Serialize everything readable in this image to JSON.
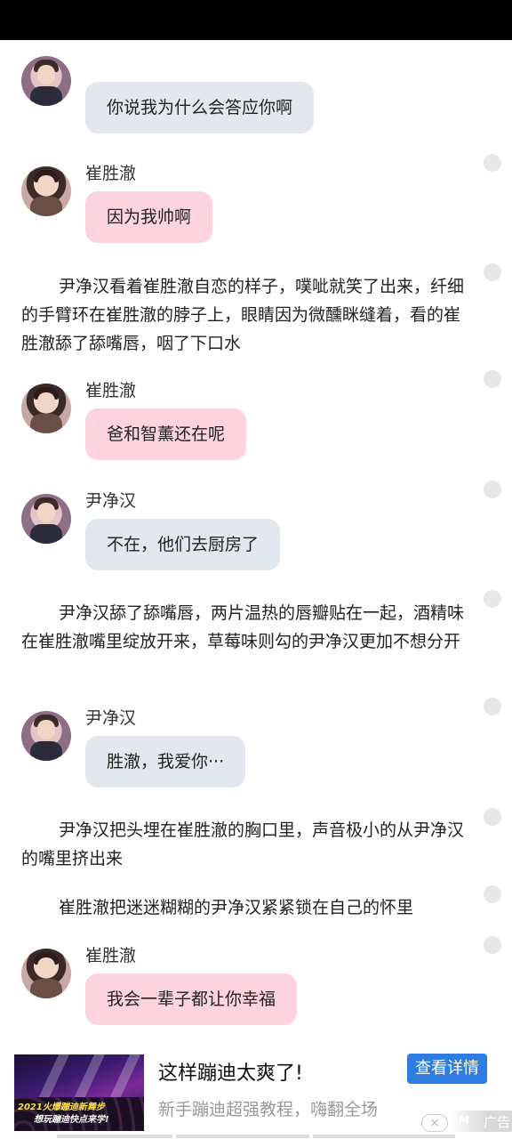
{
  "messages": [
    {
      "text": "你说我为什么会答应你啊"
    },
    {
      "name": "崔胜澈",
      "text": "因为我帅啊"
    },
    {
      "narration": "尹净汉看着崔胜澈自恋的样子，噗呲就笑了出来，纤细的手臂环在崔胜澈的脖子上，眼睛因为微醺眯缝着，看的崔胜澈舔了舔嘴唇，咽了下口水"
    },
    {
      "name": "崔胜澈",
      "text": "爸和智薰还在呢"
    },
    {
      "name": "尹净汉",
      "text": "不在，他们去厨房了"
    },
    {
      "narration": "尹净汉舔了舔嘴唇，两片温热的唇瓣贴在一起，酒精味在崔胜澈嘴里绽放开来，草莓味则勾的尹净汉更加不想分开"
    },
    {
      "name": "尹净汉",
      "text": "胜澈，我爱你···"
    },
    {
      "narration": "尹净汉把头埋在崔胜澈的胸口里，声音极小的从尹净汉的嘴里挤出来"
    },
    {
      "narration": "崔胜澈把迷迷糊糊的尹净汉紧紧锁在自己的怀里"
    },
    {
      "name": "崔胜澈",
      "text": "我会一辈子都让你幸福"
    }
  ],
  "ad": {
    "title": "这样蹦迪太爽了!",
    "description": "新手蹦迪超强教程，嗨翻全场",
    "button": "查看详情",
    "close": "×",
    "tag": "广告",
    "tag_logo": "M",
    "image_caption_1": "2021火爆蹦迪新舞步",
    "image_caption_2": "想玩蹦迪快点来学!"
  },
  "colors": {
    "status_bar": "#000000",
    "pink_bubble": "#fcd3de",
    "gray_bubble": "#e3e8ee",
    "ad_button": "#2f7de1"
  }
}
